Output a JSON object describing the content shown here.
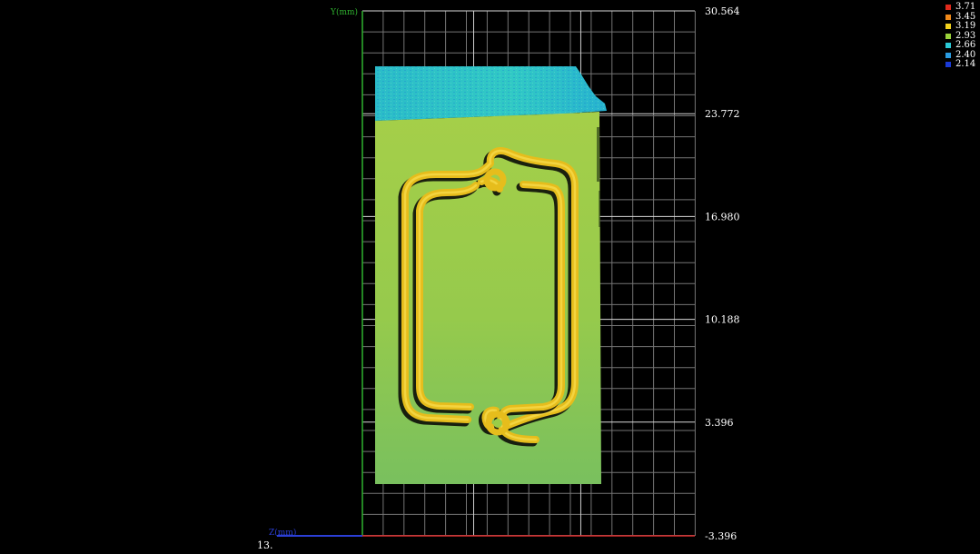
{
  "viewer": {
    "y_axis_title": "Y(mm)",
    "z_axis_title": "Z(mm)",
    "bottom_readout": "13.",
    "axis_colors": {
      "y": "#2fb22f",
      "z": "#2b3fd6",
      "x": "#d92b2b"
    },
    "background_color": "#000000",
    "grid_color": "#8a8a8a"
  },
  "y_ticks": [
    "30.564",
    "23.772",
    "16.980",
    "10.188",
    "3.396",
    "-3.396"
  ],
  "legend": {
    "items": [
      {
        "label": "3.71",
        "color": "#e02a1c"
      },
      {
        "label": "3.45",
        "color": "#f08a1a"
      },
      {
        "label": "3.19",
        "color": "#f2d21e"
      },
      {
        "label": "2.93",
        "color": "#9ad23a"
      },
      {
        "label": "2.66",
        "color": "#2bc9d6"
      },
      {
        "label": "2.40",
        "color": "#2a9be0"
      },
      {
        "label": "2.14",
        "color": "#1a3ad6"
      }
    ]
  },
  "surface": {
    "plate_color": "#96ca4c",
    "plate_edge_color": "#7cc35a",
    "top_band_color": "#2ec4c7",
    "ridge_color": "#e8c11e",
    "ridge_highlight_color": "#f6d94a",
    "groove_color": "#0b0d08"
  }
}
